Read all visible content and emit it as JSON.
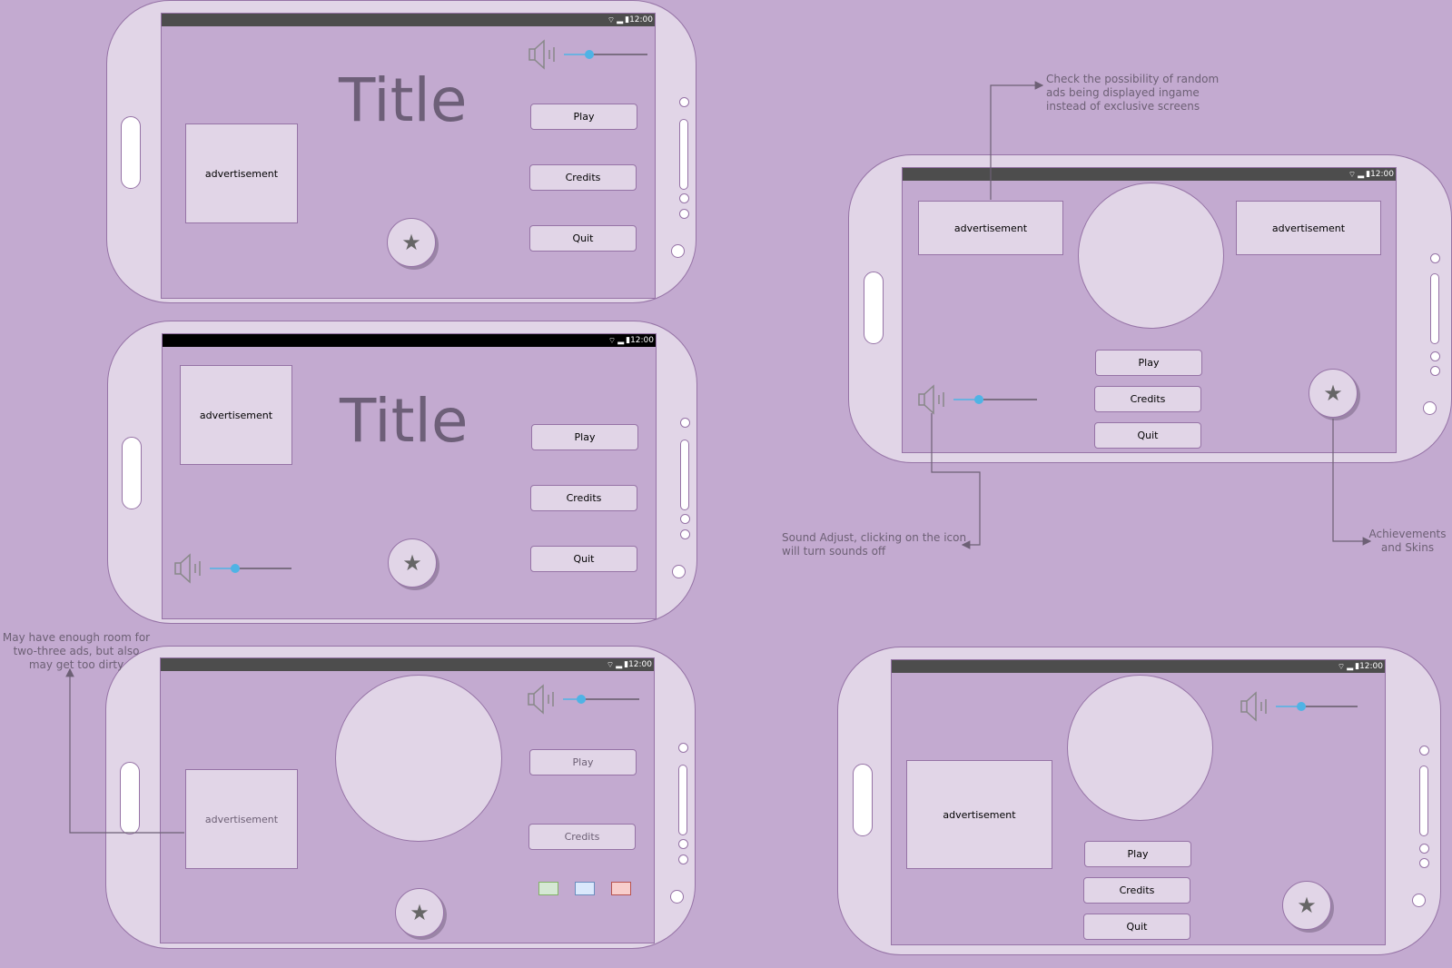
{
  "status_bar": {
    "time": "12:00",
    "icons": [
      "wifi-icon",
      "signal-icon",
      "battery-icon"
    ]
  },
  "colors": {
    "background": "#c3aad0",
    "device_body": "#e1d5e7",
    "outline": "#9673a6",
    "status_bar": "#4d4d4d",
    "slider_active": "#4fb3e5",
    "slider_track": "#333333",
    "swatch_green": "#d5e8d4",
    "swatch_blue": "#dae8fc",
    "swatch_red": "#f8cecc"
  },
  "mockups": [
    {
      "id": "mockup-1",
      "title": "Title",
      "ad": "advertisement",
      "buttons": [
        "Play",
        "Credits",
        "Quit"
      ],
      "volume_level": 0.3
    },
    {
      "id": "mockup-2",
      "title": "Title",
      "ad": "advertisement",
      "buttons": [
        "Play",
        "Credits",
        "Quit"
      ],
      "volume_level": 0.3
    },
    {
      "id": "mockup-3",
      "ad": "advertisement",
      "buttons": [
        "Play",
        "Credits"
      ],
      "volume_level": 0.3
    },
    {
      "id": "mockup-4",
      "ads": [
        "advertisement",
        "advertisement"
      ],
      "buttons": [
        "Play",
        "Credits",
        "Quit"
      ],
      "volume_level": 0.3
    },
    {
      "id": "mockup-5",
      "ad": "advertisement",
      "buttons": [
        "Play",
        "Credits",
        "Quit"
      ],
      "volume_level": 0.3
    }
  ],
  "annotations": {
    "ads_ingame": "Check the possibility of random ads being displayed ingame instead of exclusive screens",
    "sound_adjust": "Sound Adjust, clicking on the icon will turn sounds off",
    "achievements": "Achievements and Skins",
    "ad_room": "May have enough room for two-three ads, but also may get too dirty"
  },
  "star_glyph": "★"
}
